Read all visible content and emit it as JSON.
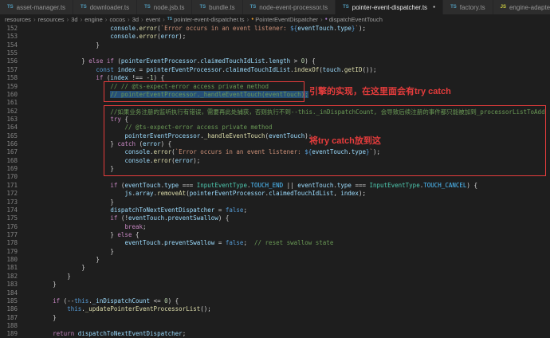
{
  "tabs": [
    {
      "label": "asset-manager.ts",
      "icon": "TS",
      "active": false,
      "modified": false
    },
    {
      "label": "downloader.ts",
      "icon": "TS",
      "active": false,
      "modified": false
    },
    {
      "label": "node.jsb.ts",
      "icon": "TS",
      "active": false,
      "modified": false
    },
    {
      "label": "bundle.ts",
      "icon": "TS",
      "active": false,
      "modified": false
    },
    {
      "label": "node-event-processor.ts",
      "icon": "TS",
      "active": false,
      "modified": false
    },
    {
      "label": "pointer-event-dispatcher.ts",
      "icon": "TS",
      "active": true,
      "modified": true
    },
    {
      "label": "factory.ts",
      "icon": "TS",
      "active": false,
      "modified": false
    },
    {
      "label": "engine-adapter.js",
      "icon": "JS",
      "active": false,
      "modified": false
    }
  ],
  "breadcrumb": {
    "items": [
      {
        "label": "resources"
      },
      {
        "label": "resources"
      },
      {
        "label": "3d"
      },
      {
        "label": "engine"
      },
      {
        "label": "cocos"
      },
      {
        "label": "3d"
      },
      {
        "label": "event"
      },
      {
        "label": "pointer-event-dispatcher.ts",
        "icon": "file-ts"
      },
      {
        "label": "PointerEventDispatcher",
        "icon": "symbol-class"
      },
      {
        "label": "dispatchEventTouch",
        "icon": "symbol-method"
      }
    ]
  },
  "editor": {
    "lines": [
      {
        "num": 152,
        "text": "                        console.error(`Error occurs in an event listener: ${eventTouch.type}`);"
      },
      {
        "num": 153,
        "text": "                        console.error(error);"
      },
      {
        "num": 154,
        "text": "                    }"
      },
      {
        "num": 155,
        "text": ""
      },
      {
        "num": 156,
        "text": "                } else if (pointerEventProcessor.claimedTouchIdList.length > 0) {"
      },
      {
        "num": 157,
        "text": "                    const index = pointerEventProcessor.claimedTouchIdList.indexOf(touch.getID());"
      },
      {
        "num": 158,
        "text": "                    if (index !== -1) {"
      },
      {
        "num": 159,
        "text": "                        // // @ts-expect-error access private method"
      },
      {
        "num": 160,
        "text": "                        // pointerEventProcessor._handleEventTouch(eventTouch);",
        "sel": true
      },
      {
        "num": 161,
        "text": ""
      },
      {
        "num": 162,
        "text": "                        //如果业务注册的监听执行有错误，需要再此处捕获，否则执行不到--this._inDispatchCount, 会导致后续注册的事件都只能被加到_processorListToAdd"
      },
      {
        "num": 163,
        "text": "                        try {"
      },
      {
        "num": 164,
        "text": "                            // @ts-expect-error access private method"
      },
      {
        "num": 165,
        "text": "                            pointerEventProcessor._handleEventTouch(eventTouch);"
      },
      {
        "num": 166,
        "text": "                        } catch (error) {"
      },
      {
        "num": 167,
        "text": "                            console.error(`Error occurs in an event listener: ${eventTouch.type}`);"
      },
      {
        "num": 168,
        "text": "                            console.error(error);"
      },
      {
        "num": 169,
        "text": "                        }"
      },
      {
        "num": 170,
        "text": ""
      },
      {
        "num": 171,
        "text": "                        if (eventTouch.type === InputEventType.TOUCH_END || eventTouch.type === InputEventType.TOUCH_CANCEL) {"
      },
      {
        "num": 172,
        "text": "                            js.array.removeAt(pointerEventProcessor.claimedTouchIdList, index);"
      },
      {
        "num": 173,
        "text": "                        }"
      },
      {
        "num": 174,
        "text": "                        dispatchToNextEventDispatcher = false;"
      },
      {
        "num": 175,
        "text": "                        if (!eventTouch.preventSwallow) {"
      },
      {
        "num": 176,
        "text": "                            break;"
      },
      {
        "num": 177,
        "text": "                        } else {"
      },
      {
        "num": 178,
        "text": "                            eventTouch.preventSwallow = false;  // reset swallow state"
      },
      {
        "num": 179,
        "text": "                        }"
      },
      {
        "num": 180,
        "text": "                    }"
      },
      {
        "num": 181,
        "text": "                }"
      },
      {
        "num": 182,
        "text": "            }"
      },
      {
        "num": 183,
        "text": "        }"
      },
      {
        "num": 184,
        "text": ""
      },
      {
        "num": 185,
        "text": "        if (--this._inDispatchCount <= 0) {"
      },
      {
        "num": 186,
        "text": "            this._updatePointerEventProcessorList();"
      },
      {
        "num": 187,
        "text": "        }"
      },
      {
        "num": 188,
        "text": ""
      },
      {
        "num": 189,
        "text": "        return dispatchToNextEventDispatcher;"
      }
    ]
  },
  "annotations": {
    "color": "#e53c3c",
    "note1": "引擎的实现，在这里面会有try catch",
    "note2": "将try catch放到这"
  }
}
